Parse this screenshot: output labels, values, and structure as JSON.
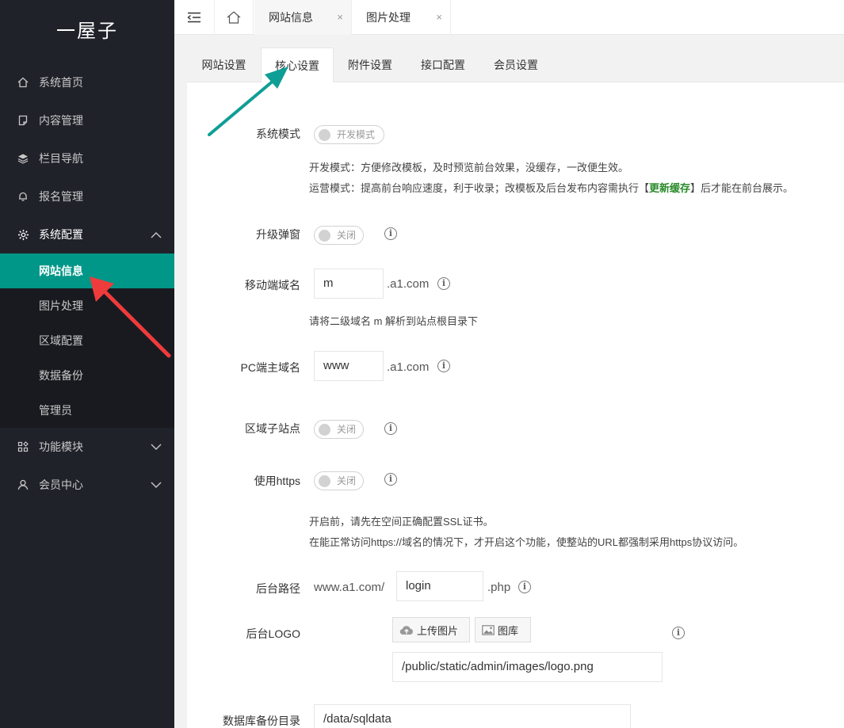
{
  "sidebar": {
    "logo": "一屋子",
    "menu": [
      {
        "label": "系统首页"
      },
      {
        "label": "内容管理"
      },
      {
        "label": "栏目导航"
      },
      {
        "label": "报名管理"
      },
      {
        "label": "系统配置"
      }
    ],
    "submenu": [
      {
        "label": "网站信息"
      },
      {
        "label": "图片处理"
      },
      {
        "label": "区域配置"
      },
      {
        "label": "数据备份"
      },
      {
        "label": "管理员"
      }
    ],
    "menu_after": [
      {
        "label": "功能模块"
      },
      {
        "label": "会员中心"
      }
    ]
  },
  "topbar": {
    "tabs": [
      {
        "label": "网站信息",
        "close": "×"
      },
      {
        "label": "图片处理",
        "close": "×"
      }
    ]
  },
  "content_tabs": [
    "网站设置",
    "核心设置",
    "附件设置",
    "接口配置",
    "会员设置"
  ],
  "form": {
    "mode": {
      "label": "系统模式",
      "switch_text": "开发模式",
      "help1": "开发模式：方便修改模板，及时预览前台效果，没缓存，一改便生效。",
      "help2_pre": "运营模式：提高前台响应速度，利于收录；改模板及后台发布内容需执行【",
      "help2_hl": "更新缓存",
      "help2_post": "】后才能在前台展示。"
    },
    "popup": {
      "label": "升级弹窗",
      "switch_text": "关闭"
    },
    "mobile": {
      "label": "移动端域名",
      "value": "m",
      "suffix": ".a1.com",
      "help": "请将二级域名 m 解析到站点根目录下"
    },
    "pc": {
      "label": "PC端主域名",
      "value": "www",
      "suffix": ".a1.com"
    },
    "region": {
      "label": "区域子站点",
      "switch_text": "关闭"
    },
    "https": {
      "label": "使用https",
      "switch_text": "关闭",
      "help1": "开启前，请先在空间正确配置SSL证书。",
      "help2": "在能正常访问https://域名的情况下，才开启这个功能，使整站的URL都强制采用https协议访问。"
    },
    "admin_path": {
      "label": "后台路径",
      "prefix": "www.a1.com/",
      "value": "login",
      "suffix": ".php"
    },
    "admin_logo": {
      "label": "后台LOGO",
      "upload_label": "上传图片",
      "gallery_label": "图库",
      "value": "/public/static/admin/images/logo.png"
    },
    "backup_dir": {
      "label": "数据库备份目录",
      "value": "/data/sqldata"
    }
  },
  "colors": {
    "sidebar_bg": "#20222a",
    "active": "#009688",
    "teal_arrow": "#0f9e96",
    "red_arrow": "#ee3b3b"
  }
}
